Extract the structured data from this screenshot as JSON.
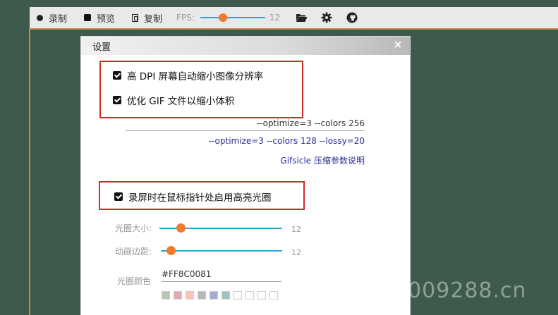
{
  "toolbar": {
    "record_label": "录制",
    "preview_label": "预览",
    "copy_label": "复制",
    "fps_label": "FPS:",
    "fps_value": "12",
    "fps_fraction": 0.33
  },
  "dialog": {
    "title": "设置",
    "close_symbol": "×",
    "hidpi_label": "高 DPI 屏幕自动缩小图像分辨率",
    "optimize_gif_label": "优化 GIF 文件以缩小体积",
    "optimize_value": "--optimize=3 --colors 256",
    "optimize_hint": "--optimize=3 --colors 128 --lossy=20",
    "gifsicle_link": "Gifsicle 压缩参数说明",
    "highlight_label": "录屏时在鼠标指针处启用高亮光圈",
    "halo_size_label": "光圈大小:",
    "halo_size_value": "12",
    "halo_size_fraction": 0.15,
    "anim_margin_label": "动画边距:",
    "anim_margin_value": "12",
    "anim_margin_fraction": 0.05,
    "halo_color_label": "光圈颜色",
    "halo_color_value": "#FF8C0081"
  },
  "swatch_colors": [
    "#b9c7b0",
    "#e3a8ae",
    "#f7c5b8",
    "#b8b8b8",
    "#a9a9d4",
    "#9bc5c5",
    "#ffffff",
    "#ffffff",
    "#ffffff",
    "#ffffff"
  ],
  "colors": {
    "accent_track": "#2aa4d6",
    "knob": "#f07b2b",
    "frame": "#c8874e",
    "highlight_box": "#d32b2b",
    "background": "#3e5a4d"
  },
  "watermark": "009288.cn"
}
